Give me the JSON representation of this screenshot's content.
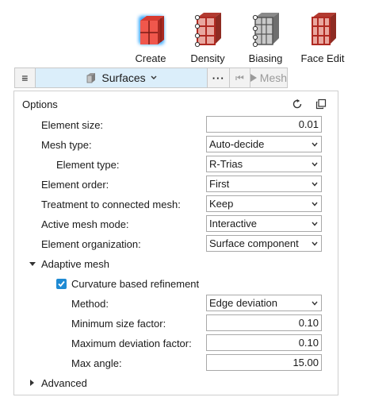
{
  "tools": [
    {
      "label": "Create",
      "icon": "create-icon"
    },
    {
      "label": "Density",
      "icon": "density-icon"
    },
    {
      "label": "Biasing",
      "icon": "biasing-icon"
    },
    {
      "label": "Face Edit",
      "icon": "face-edit-icon"
    }
  ],
  "toolbar": {
    "menu_glyph": "≡",
    "surfaces_label": "Surfaces",
    "more_glyph": "···",
    "first_glyph": "⏮",
    "mesh_label": "Mesh"
  },
  "options": {
    "title": "Options",
    "rows": {
      "element_size": {
        "label": "Element size:",
        "value": "0.01"
      },
      "mesh_type": {
        "label": "Mesh type:",
        "value": "Auto-decide"
      },
      "element_type": {
        "label": "Element type:",
        "value": "R-Trias"
      },
      "element_order": {
        "label": "Element order:",
        "value": "First"
      },
      "treatment": {
        "label": "Treatment to connected mesh:",
        "value": "Keep"
      },
      "active_mode": {
        "label": "Active mesh mode:",
        "value": "Interactive"
      },
      "element_org": {
        "label": "Element organization:",
        "value": "Surface component"
      }
    },
    "adaptive": {
      "label": "Adaptive mesh",
      "curvature_label": "Curvature based refinement",
      "curvature_checked": true,
      "method": {
        "label": "Method:",
        "value": "Edge deviation"
      },
      "min_size": {
        "label": "Minimum size factor:",
        "value": "0.10"
      },
      "max_dev": {
        "label": "Maximum deviation factor:",
        "value": "0.10"
      },
      "max_angle": {
        "label": "Max angle:",
        "value": "15.00"
      }
    },
    "advanced_label": "Advanced"
  },
  "colors": {
    "accent": "#1f8ad3",
    "highlight": "#dbeefa",
    "create_red": "#e8463c",
    "density_red": "#c0392b"
  }
}
